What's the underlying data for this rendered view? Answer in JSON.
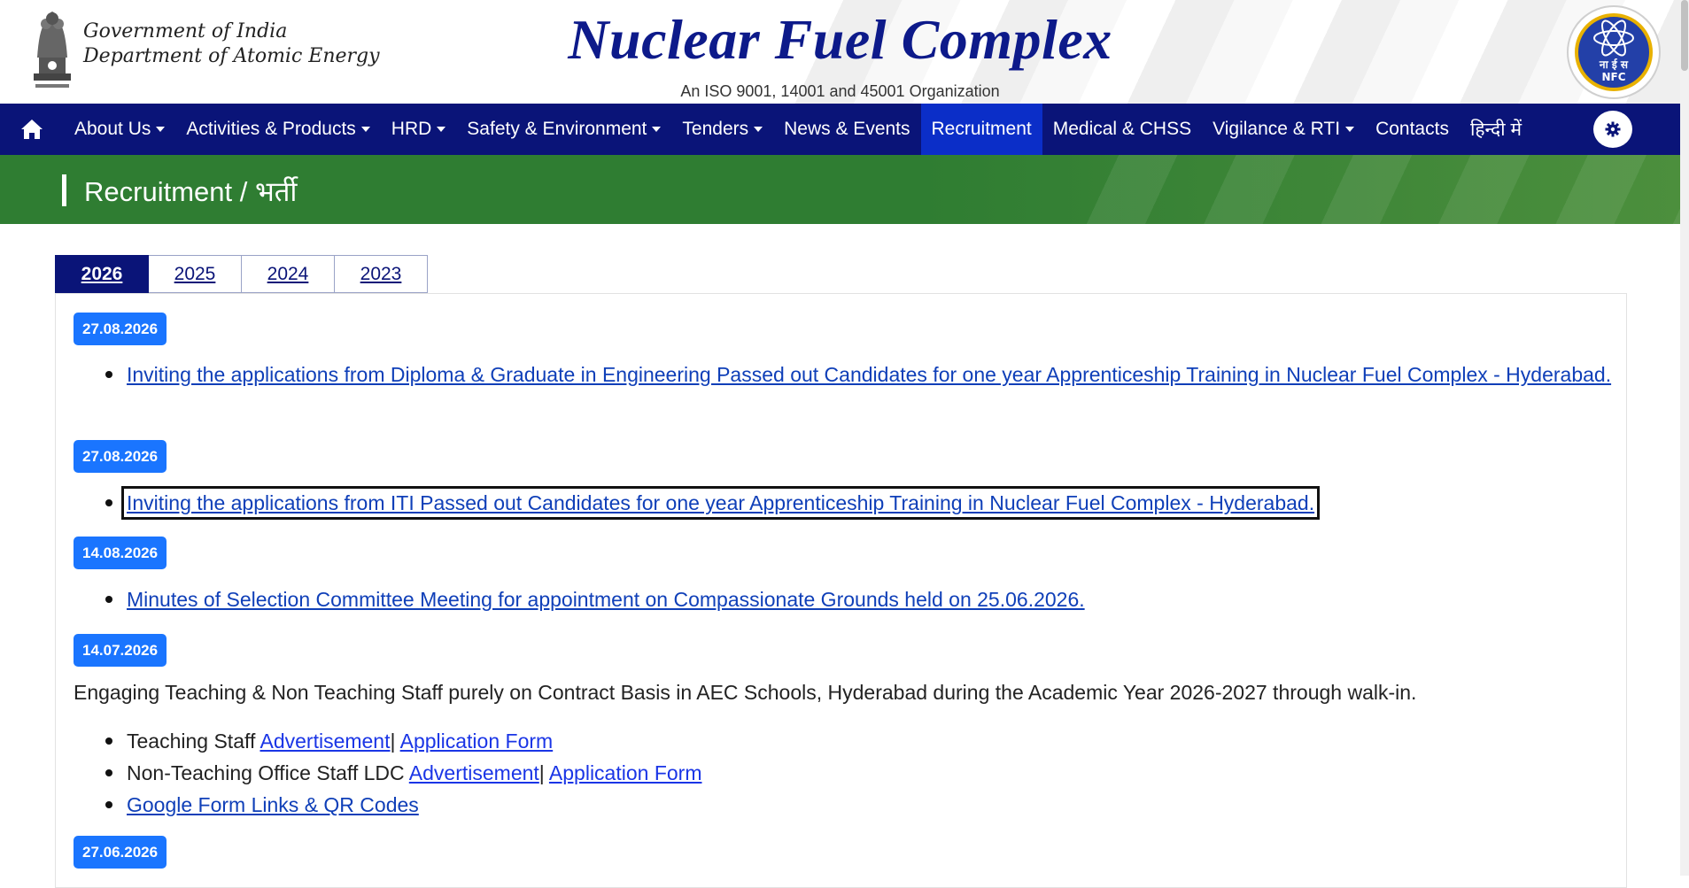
{
  "header": {
    "gov_line1": "Government of India",
    "gov_line2": "Department of Atomic Energy",
    "title": "Nuclear Fuel Complex",
    "subtitle": "An ISO 9001, 14001 and 45001 Organization",
    "logo_hindi": "ना ई स",
    "logo_abbr": "NFC"
  },
  "nav": {
    "items": [
      {
        "label": "About Us",
        "dropdown": true
      },
      {
        "label": "Activities & Products",
        "dropdown": true
      },
      {
        "label": "HRD",
        "dropdown": true
      },
      {
        "label": "Safety & Environment",
        "dropdown": true
      },
      {
        "label": "Tenders",
        "dropdown": true
      },
      {
        "label": "News & Events",
        "dropdown": false
      },
      {
        "label": "Recruitment",
        "dropdown": false,
        "active": true
      },
      {
        "label": "Medical & CHSS",
        "dropdown": false
      },
      {
        "label": "Vigilance & RTI",
        "dropdown": true
      },
      {
        "label": "Contacts",
        "dropdown": false
      },
      {
        "label": "हिन्दी में",
        "dropdown": false
      }
    ]
  },
  "banner": {
    "title": "Recruitment / भर्ती"
  },
  "tabs": [
    "2026",
    "2025",
    "2024",
    "2023"
  ],
  "tabs_active": "2026",
  "entries": [
    {
      "date": "27.08.2026",
      "link": "Inviting the applications from Diploma & Graduate in Engineering Passed out Candidates for one year Apprenticeship Training in Nuclear Fuel Complex - Hyderabad."
    },
    {
      "date": "27.08.2026",
      "link": "Inviting the applications from ITI Passed out Candidates for one year Apprenticeship Training in Nuclear Fuel Complex - Hyderabad."
    },
    {
      "date": "14.08.2026",
      "link": "Minutes of Selection Committee Meeting for appointment on Compassionate Grounds held on 25.06.2026."
    },
    {
      "date": "14.07.2026",
      "description": "Engaging Teaching & Non Teaching Staff purely on Contract Basis in AEC Schools, Hyderabad during the Academic Year 2026-2027 through walk-in.",
      "teaching_label": "Teaching Staff",
      "nonteaching_label": "Non-Teaching Office Staff LDC",
      "advertisement": "Advertisement",
      "separator": "|",
      "application_form": "Application Form",
      "google_form": "Google Form Links & QR Codes"
    },
    {
      "date": "27.06.2026"
    }
  ],
  "colors": {
    "nav_bg": "#0a1478",
    "active_nav": "#0b2ec8",
    "banner_green": "#2f7d32",
    "badge_blue": "#1a75ff",
    "link": "#0f3fb8"
  }
}
